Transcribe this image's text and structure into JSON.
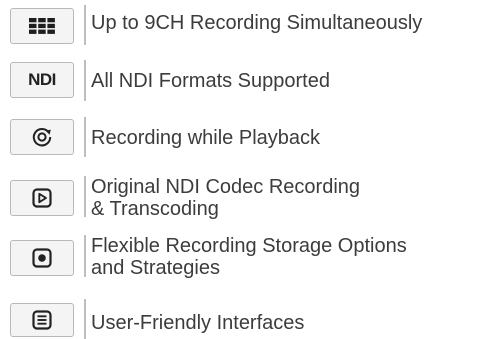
{
  "features": [
    {
      "icon": "grid-icon",
      "lines": [
        "Up to 9CH Recording Simultaneously"
      ]
    },
    {
      "icon": "ndi-logo-icon",
      "icon_text": "NDI",
      "lines": [
        "All NDI Formats Supported"
      ]
    },
    {
      "icon": "record-playback-icon",
      "lines": [
        "Recording while Playback"
      ]
    },
    {
      "icon": "play-square-icon",
      "lines": [
        "Original NDI Codec Recording",
        "& Transcoding"
      ]
    },
    {
      "icon": "record-square-icon",
      "lines": [
        "Flexible Recording Storage Options",
        "and Strategies"
      ]
    },
    {
      "icon": "list-icon",
      "lines": [
        "User-Friendly Interfaces"
      ]
    }
  ]
}
